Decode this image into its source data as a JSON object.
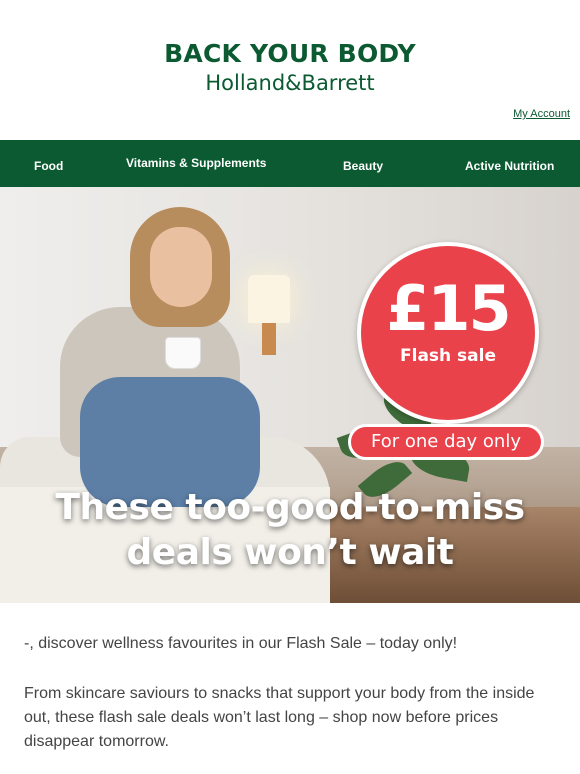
{
  "header": {
    "tagline": "BACK YOUR BODY",
    "brand": "Holland&Barrett",
    "account_link": "My Account"
  },
  "nav": {
    "items": [
      {
        "label": "Food"
      },
      {
        "label": "Vitamins & Supplements"
      },
      {
        "label": "Beauty"
      },
      {
        "label": "Active Nutrition"
      }
    ]
  },
  "hero": {
    "price": "£15",
    "price_caption": "Flash sale",
    "duration": "For one day only",
    "headline_line1": "These too-good-to-miss",
    "headline_line2": "deals won’t wait"
  },
  "content": {
    "intro": "-, discover wellness favourites in our Flash Sale – today only!",
    "paragraph": "From skincare saviours to snacks that support your body from the inside out, these flash sale deals won’t last long – shop now before prices disappear tomorrow."
  },
  "colors": {
    "brand_green": "#0b5a31",
    "sale_red": "#e9424b"
  }
}
